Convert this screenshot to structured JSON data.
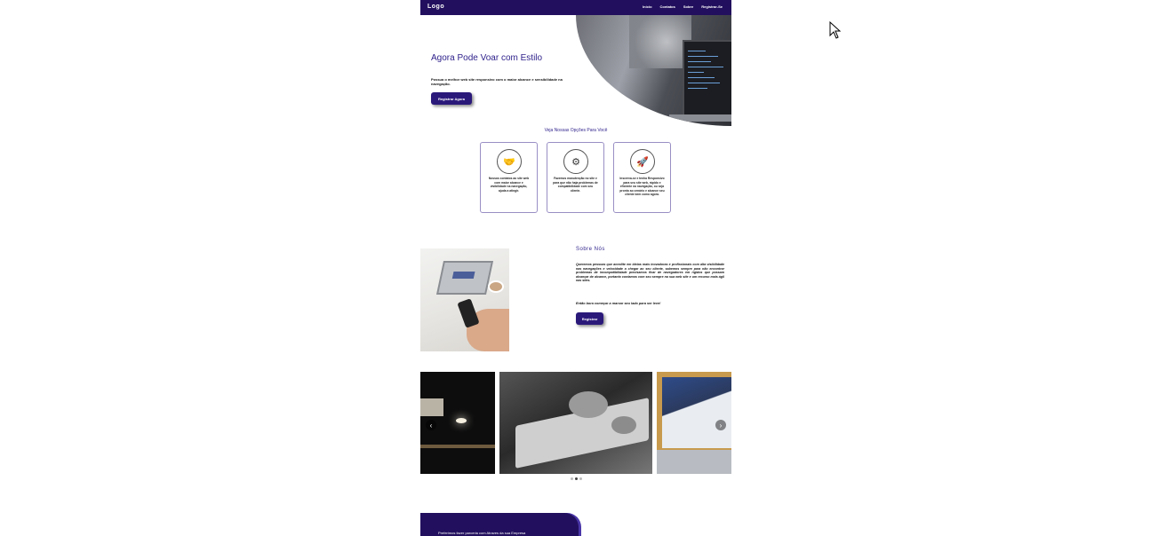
{
  "nav": {
    "logo": "Logo",
    "links": [
      "Início",
      "Contatos",
      "Sobre",
      "Registrar-Se"
    ]
  },
  "hero": {
    "title": "Agora Pode Voar com Estilo",
    "subtitle": "Possua o melhor web site responsivo com o maior alcance e sensibilidade na navegação.",
    "button": "Registrar Agora"
  },
  "options": {
    "title": "Veja Nossas Opções Para Você",
    "cards": [
      {
        "icon": "handshake-icon",
        "glyph": "🤝",
        "text": "Nossos contatos ao site web com maior alcance e visibilidade na navegação, ajuda a atingir."
      },
      {
        "icon": "gears-icon",
        "glyph": "⚙",
        "text": "Fazemos manutenção no site e para que não haja problemas de compatibilidade com seu cliente."
      },
      {
        "icon": "rocket-icon",
        "glyph": "🚀",
        "text": "Inscreva-se e tenha Responsivo para seu site web, rápido e eficiente na navegação, ou seja pronto ao cenário e alcance seu cliente bem como agora."
      }
    ]
  },
  "about": {
    "title": "Sobre Nós",
    "text": "Queremos pessoas que acredite em ideias mais inovadoras e profissionais com alta visibilidade nas navegações e velocidade a chegar ao seu cliente, sabemos sempre para não encontrar problemas de incompatibilidade precisamos ficar de navegadores em rígidos que possam alcançar de alcance, portanto contamos com seu sempre na sua web site e um recurso mais ágil nas sites.",
    "cta": "Então bora começar a marcar seu lado para ser leve!",
    "button": "Registrar"
  },
  "carousel": {
    "prev": "‹",
    "next": "›",
    "active_index": 1,
    "slide_count": 3
  },
  "footer": {
    "text": "Preferimos fazer parceria com Atraves da sua Empresa"
  }
}
